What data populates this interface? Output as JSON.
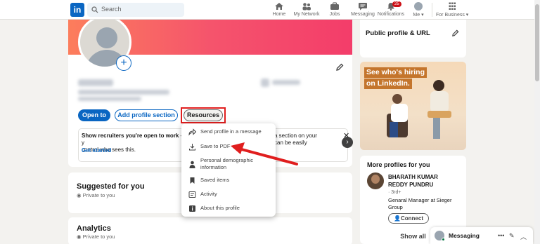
{
  "nav": {
    "logo": "in",
    "search_placeholder": "Search",
    "items": [
      {
        "label": "Home",
        "icon": "home-icon"
      },
      {
        "label": "My Network",
        "icon": "network-icon"
      },
      {
        "label": "Jobs",
        "icon": "jobs-icon"
      },
      {
        "label": "Messaging",
        "icon": "messaging-icon"
      },
      {
        "label": "Notifications",
        "icon": "bell-icon",
        "badge": "25"
      },
      {
        "label": "Me ▾",
        "icon": "avatar"
      },
      {
        "label": "For Business ▾",
        "icon": "grid-icon"
      }
    ]
  },
  "profile": {
    "buttons": {
      "open_to": "Open to",
      "add_section": "Add profile section",
      "resources": "Resources"
    },
    "open_to_work": {
      "title": "Show recruiters you're open to work",
      "text_left": " — y",
      "line2": "control who sees this.",
      "right_line1": "a section on your",
      "right_line2": "can be easily",
      "link": "Get started",
      "close": "✕"
    }
  },
  "dropdown": {
    "items": [
      {
        "label": "Send profile in a message",
        "icon": "share-icon"
      },
      {
        "label": "Save to PDF",
        "icon": "download-icon"
      },
      {
        "label": "Personal demographic information",
        "icon": "person-icon"
      },
      {
        "label": "Saved items",
        "icon": "bookmark-icon"
      },
      {
        "label": "Activity",
        "icon": "activity-icon"
      },
      {
        "label": "About this profile",
        "icon": "info-icon"
      }
    ]
  },
  "suggested": {
    "title": "Suggested for you",
    "privacy": "Private to you"
  },
  "analytics": {
    "title": "Analytics",
    "privacy": "Private to you"
  },
  "public_profile": {
    "title": "Public profile & URL"
  },
  "ad": {
    "line1": "See who's hiring",
    "line2": "on LinkedIn."
  },
  "more_profiles": {
    "title": "More profiles for you",
    "person": {
      "name": "BHARATH KUMAR REDDY PUNDRU",
      "degree": "· 3rd+",
      "headline": "Genaral Manager at Sieger Group"
    },
    "connect": "Connect",
    "show_all": "Show all"
  },
  "messaging": {
    "label": "Messaging",
    "more": "•••",
    "edit": "✎",
    "toggle": "︿"
  },
  "colors": {
    "brand": "#0a66c2",
    "annotation": "#e01e1e",
    "badge": "#cc1016"
  }
}
